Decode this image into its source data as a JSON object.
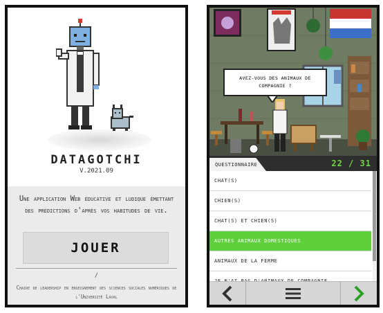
{
  "intro": {
    "title": "DATAGOTCHI",
    "version": "V.2021.09",
    "description": "Une application Web éducative et ludique émettant des prédictions d'après vos habitudes de vie.",
    "play_label": "JOUER",
    "separator": "/",
    "footer": "Chaire de leadership en enseignement des sciences sociales numériques de l'Université Laval"
  },
  "game": {
    "speech_bubble": "AVEZ-VOUS DES ANIMAUX DE COMPAGNIE ?",
    "tab_label": "QUESTIONNAIRE",
    "counter": "22 / 31",
    "options": [
      "CHAT(S)",
      "CHIEN(S)",
      "CHAT(S) ET CHIEN(S)",
      "AUTRES ANIMAUX DOMESTIQUES",
      "ANIMAUX DE LA FERME",
      "JE N'AI PAS D'ANIMAUX DE COMPAGNIE"
    ],
    "selected_index": 3,
    "nav": {
      "prev_icon": "chevron-left-icon",
      "menu_icon": "hamburger-menu-icon",
      "next_icon": "chevron-right-icon"
    }
  },
  "colors": {
    "accent_green": "#5fcf3b",
    "counter_green": "#6fd64a",
    "robot_blue": "#7fb0e0"
  }
}
